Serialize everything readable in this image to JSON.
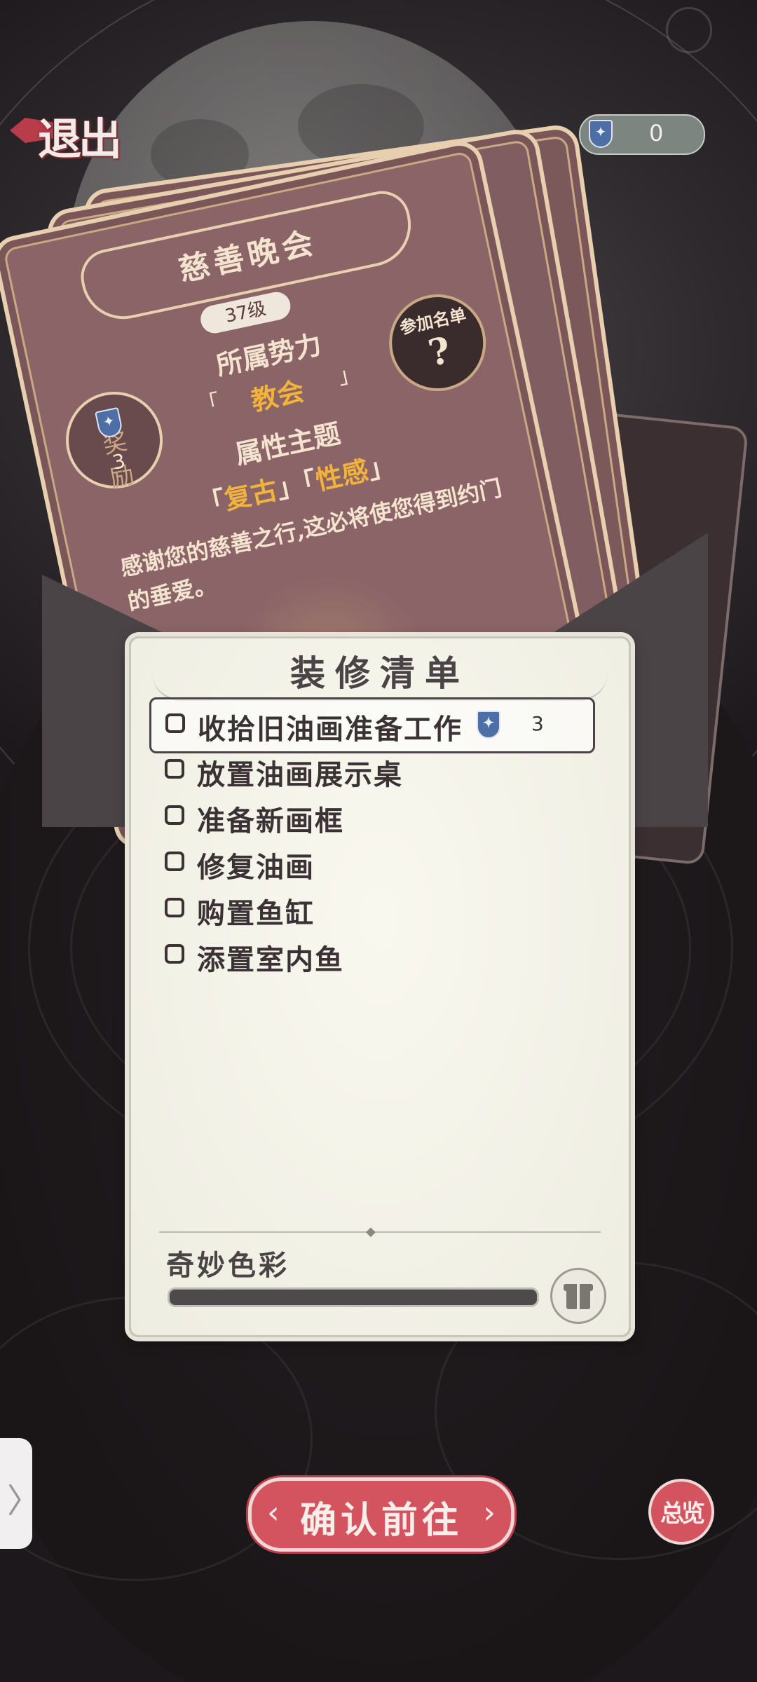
{
  "header": {
    "exit_label": "退出",
    "currency_value": "0"
  },
  "event_card": {
    "title": "慈善晚会",
    "level": "37级",
    "faction_label": "所属势力",
    "faction_value": "教会",
    "theme_label": "属性主题",
    "themes": [
      "复古",
      "性感"
    ],
    "description": "感谢您的慈善之行,这必将使您得到约门的垂爱。",
    "reward_label": "奖励",
    "reward_count": "3",
    "join_label": "参加名单",
    "join_symbol": "?"
  },
  "checklist": {
    "title": "装修清单",
    "tasks": [
      {
        "label": "收拾旧油画准备工作",
        "reward": "3",
        "selected": true
      },
      {
        "label": "放置油画展示桌"
      },
      {
        "label": "准备新画框"
      },
      {
        "label": "修复油画"
      },
      {
        "label": "购置鱼缸"
      },
      {
        "label": "添置室内鱼"
      }
    ],
    "bottom_label": "奇妙色彩",
    "progress": 0
  },
  "footer": {
    "side_tab_symbol": "〉",
    "confirm_label": "确认前往",
    "confirm_left_arrow": "‹",
    "confirm_right_arrow": "›",
    "overview_label": "总览"
  },
  "colors": {
    "accent_red": "#d3535e",
    "card_rose": "#8a6467",
    "gold_text": "#f2b33c",
    "panel_paper": "#f9f8ef"
  },
  "icons": {
    "currency": "shield-badge-icon",
    "gift": "gift-icon"
  }
}
